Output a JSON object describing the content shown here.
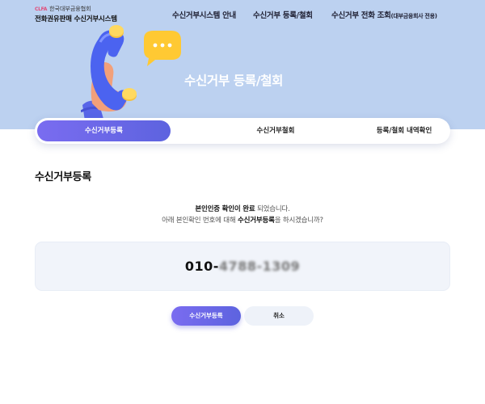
{
  "header": {
    "org_mark": "CLFA",
    "org_name": "한국대부금융협회",
    "site_title": "전화권유판매 수신거부시스템",
    "nav": [
      {
        "label": "수신거부시스템 안내"
      },
      {
        "label": "수신거부 등록/철회"
      },
      {
        "label": "수신거부 전화 조회",
        "suffix": "(대부금융회사 전용)"
      }
    ]
  },
  "hero": {
    "title": "수신거부 등록/철회",
    "bubble_dots": "•••"
  },
  "tabs": [
    {
      "label": "수신거부등록",
      "active": true
    },
    {
      "label": "수신거부철회",
      "active": false
    },
    {
      "label": "등록/철회 내역확인",
      "active": false
    }
  ],
  "main": {
    "section_title": "수신거부등록",
    "message": {
      "line1_bold": "본인인증 확인이 완료",
      "line1_rest": " 되었습니다.",
      "line2_pre": "아래 본인확인 번호에 대해 ",
      "line2_bold": "수신거부등록",
      "line2_post": "을 하시겠습니까?"
    },
    "phone": {
      "prefix": "010-",
      "masked": "4788-1309"
    },
    "buttons": {
      "confirm": "수신거부등록",
      "cancel": "취소"
    }
  },
  "colors": {
    "hero_bg": "#bcd1f0",
    "accent": "#6b5fe3",
    "box_bg": "#f1f4fa"
  }
}
